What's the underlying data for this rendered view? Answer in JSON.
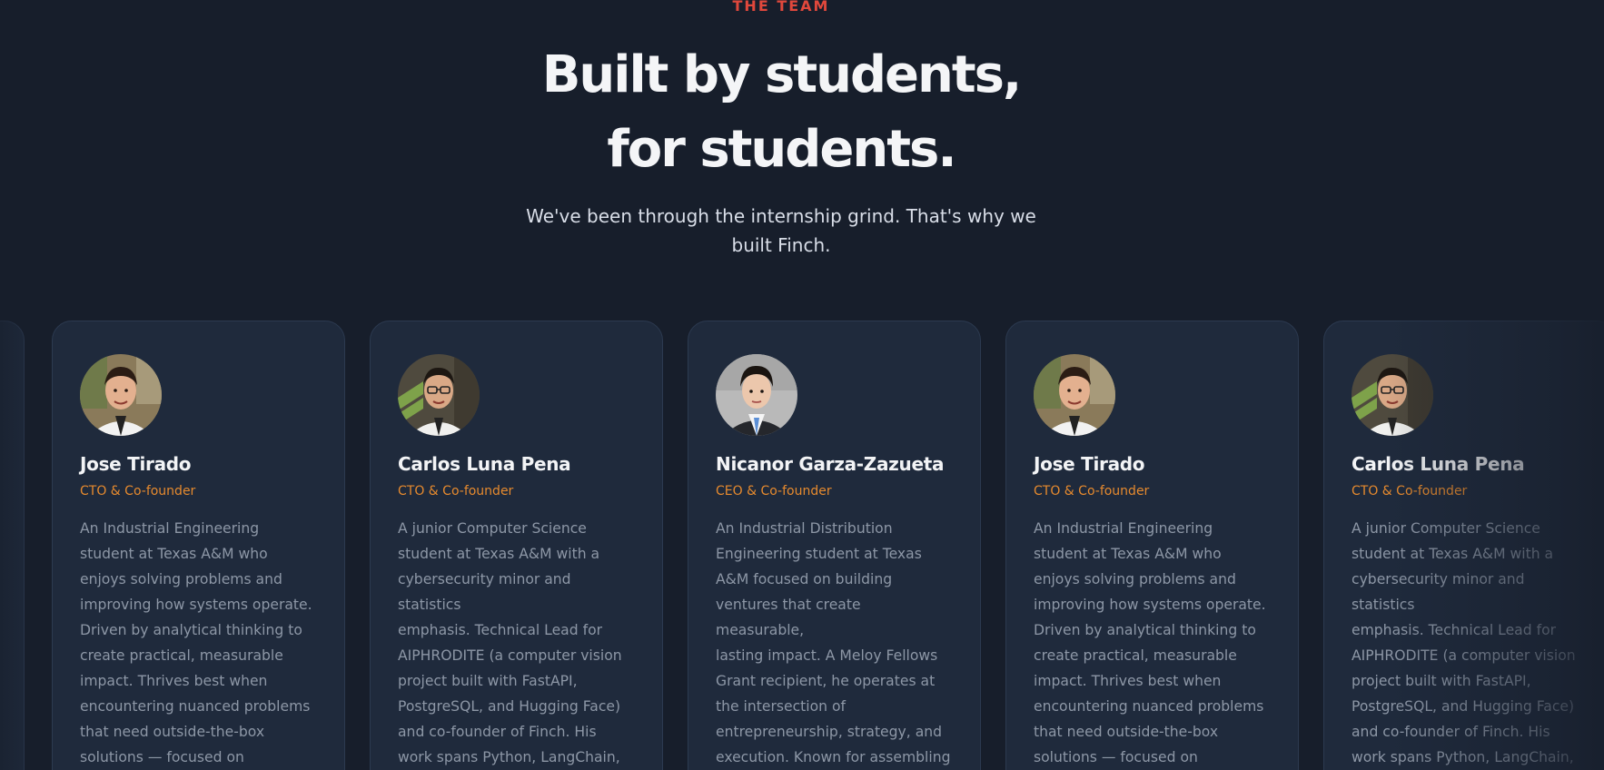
{
  "section": {
    "eyebrow": "THE TEAM",
    "headline_line1": "Built by students,",
    "headline_line2": "for students.",
    "subtitle": "We've been through the internship grind. That's why we built Finch."
  },
  "colors": {
    "background": "#171e2b",
    "card": "#1f2a3c",
    "accent_eyebrow": "#e0483c",
    "accent_role": "#e68a2e",
    "heading": "#f4f5f7",
    "body_text": "#8d97a6"
  },
  "team": [
    {
      "name": "Jose Tirado",
      "role": "CTO & Co-founder",
      "bio": "An Industrial Engineering\nstudent at Texas A&M who\nenjoys solving problems and\nimproving how systems operate.\nDriven by analytical thinking to\ncreate practical, measurable\nimpact. Thrives best when\nencountering nuanced problems\nthat need outside-the-box\nsolutions — focused on",
      "avatar_icon": "person-photo-icon"
    },
    {
      "name": "Carlos Luna Pena",
      "role": "CTO & Co-founder",
      "bio": "A junior Computer Science\nstudent at Texas A&M with a\ncybersecurity minor and statistics\nemphasis. Technical Lead for\nAIPHRODITE (a computer vision\nproject built with FastAPI,\nPostgreSQL, and Hugging Face)\nand co-founder of Finch. His\nwork spans Python, LangChain,\nLaTeX resume generation,",
      "avatar_icon": "person-photo-icon"
    },
    {
      "name": "Nicanor Garza-Zazueta",
      "role": "CEO & Co-founder",
      "bio": "An Industrial Distribution\nEngineering student at Texas\nA&M focused on building\nventures that create measurable,\nlasting impact. A Meloy Fellows\nGrant recipient, he operates at\nthe intersection of\nentrepreneurship, strategy, and\nexecution. Known for assembling\nhigh-performing teams and",
      "avatar_icon": "person-photo-icon"
    },
    {
      "name": "Jose Tirado",
      "role": "CTO & Co-founder",
      "bio": "An Industrial Engineering\nstudent at Texas A&M who\nenjoys solving problems and\nimproving how systems operate.\nDriven by analytical thinking to\ncreate practical, measurable\nimpact. Thrives best when\nencountering nuanced problems\nthat need outside-the-box\nsolutions — focused on",
      "avatar_icon": "person-photo-icon"
    },
    {
      "name": "Carlos Luna Pena",
      "role": "CTO & Co-founder",
      "bio": "A junior Computer Science\nstudent at Texas A&M with a\ncybersecurity minor and statistics\nemphasis. Technical Lead for\nAIPHRODITE (a computer vision\nproject built with FastAPI,\nPostgreSQL, and Hugging Face)\nand co-founder of Finch. His\nwork spans Python, LangChain,\nLaTeX resume generation,",
      "avatar_icon": "person-photo-icon"
    }
  ]
}
